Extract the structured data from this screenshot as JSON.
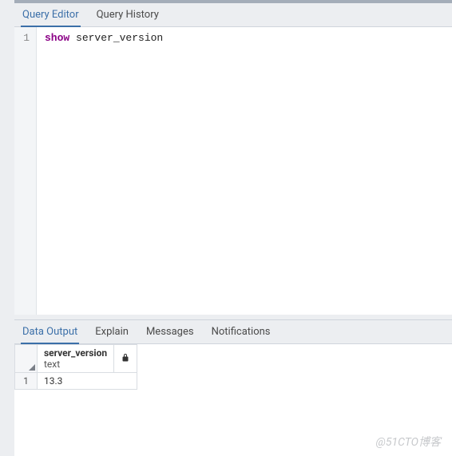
{
  "editor_tabs": {
    "query_editor": "Query Editor",
    "query_history": "Query History",
    "active": "query_editor"
  },
  "code": {
    "line_no": "1",
    "keyword": "show",
    "rest": " server_version"
  },
  "result_tabs": {
    "data_output": "Data Output",
    "explain": "Explain",
    "messages": "Messages",
    "notifications": "Notifications",
    "active": "data_output"
  },
  "result": {
    "column": {
      "name": "server_version",
      "type": "text"
    },
    "rows": [
      {
        "n": "1",
        "value": "13.3"
      }
    ]
  },
  "watermark": "@51CTO博客"
}
